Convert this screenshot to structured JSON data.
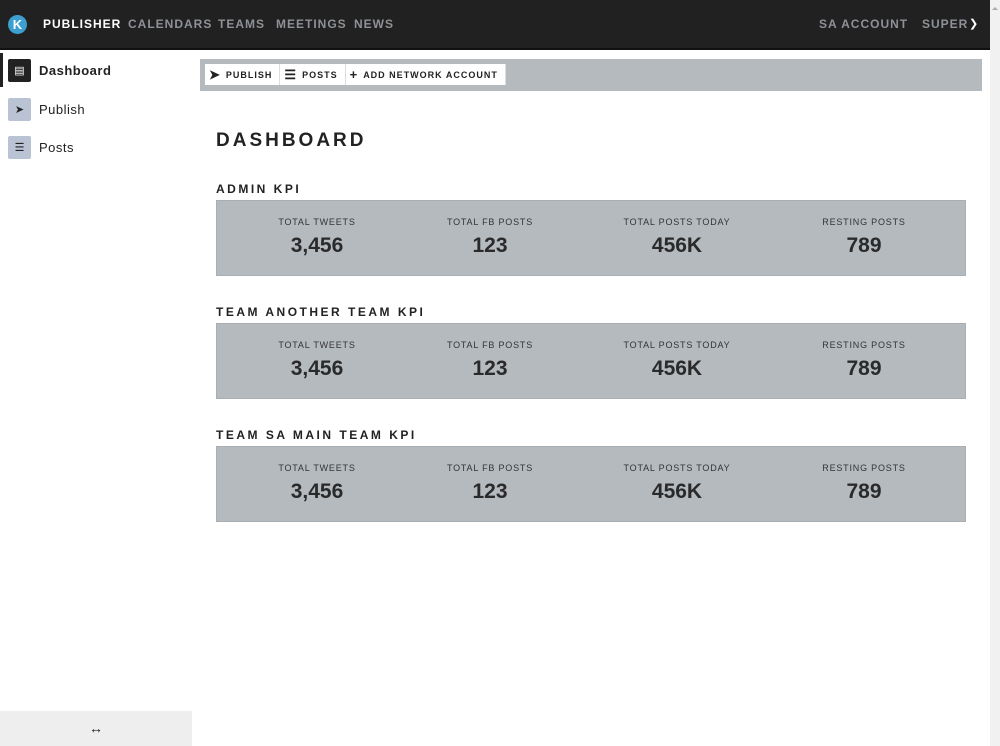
{
  "topbar": {
    "logo": "K",
    "nav": [
      "PUBLISHER",
      "CALENDARS",
      "TEAMS",
      "MEETINGS",
      "NEWS"
    ],
    "account": "SA ACCOUNT",
    "user": "SUPER"
  },
  "sidebar": {
    "items": [
      {
        "label": "Dashboard"
      },
      {
        "label": "Publish"
      },
      {
        "label": "Posts"
      }
    ],
    "resize_icon": "↔"
  },
  "toolbar": {
    "publish": "PUBLISH",
    "posts": "POSTS",
    "add": "ADD NETWORK ACCOUNT"
  },
  "page_title": "DASHBOARD",
  "sections": [
    {
      "title": "ADMIN KPI",
      "kpis": [
        {
          "label": "TOTAL TWEETS",
          "value": "3,456"
        },
        {
          "label": "TOTAL FB POSTS",
          "value": "123"
        },
        {
          "label": "TOTAL POSTS TODAY",
          "value": "456K"
        },
        {
          "label": "RESTING POSTS",
          "value": "789"
        }
      ]
    },
    {
      "title": "TEAM ANOTHER TEAM KPI",
      "kpis": [
        {
          "label": "TOTAL TWEETS",
          "value": "3,456"
        },
        {
          "label": "TOTAL FB POSTS",
          "value": "123"
        },
        {
          "label": "TOTAL POSTS TODAY",
          "value": "456K"
        },
        {
          "label": "RESTING POSTS",
          "value": "789"
        }
      ]
    },
    {
      "title": "TEAM SA MAIN TEAM KPI",
      "kpis": [
        {
          "label": "TOTAL TWEETS",
          "value": "3,456"
        },
        {
          "label": "TOTAL FB POSTS",
          "value": "123"
        },
        {
          "label": "TOTAL POSTS TODAY",
          "value": "456K"
        },
        {
          "label": "RESTING POSTS",
          "value": "789"
        }
      ]
    }
  ]
}
